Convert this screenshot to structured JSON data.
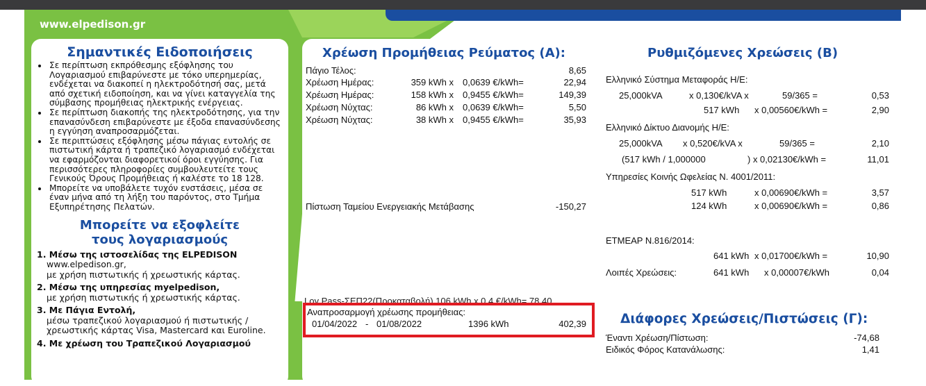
{
  "website": "www.elpedison.gr",
  "left_panel": {
    "title": "Σημαντικές Ειδοποιήσεις",
    "notices": [
      "Σε περίπτωση εκπρόθεσμης εξόφλησης του Λογαριασμού επιβαρύνεστε με τόκο υπερημερίας, ενδέχεται να διακοπεί η ηλεκτροδότησή σας, μετά από σχετική ειδοποίηση, και να γίνει καταγγελία της σύμβασης προμήθειας ηλεκτρικής ενέργειας.",
      "Σε περίπτωση διακοπής της ηλεκτροδότησης, για την επανασύνδεση επιβαρύνεστε με έξοδα επανασύνδεσης η εγγύηση αναπροσαρμόζεται.",
      "Σε περιπτώσεις εξόφλησης μέσω πάγιας εντολής σε πιστωτική κάρτα ή τραπεζικό λογαριασμό ενδέχεται να εφαρμόζονται διαφορετικοί όροι εγγύησης. Για περισσότερες πληροφορίες συμβουλευτείτε τους Γενικούς Όρους Προμήθειας ή καλέστε το 18 128.",
      "Μπορείτε να υποβάλετε τυχόν ενστάσεις, μέσα σε έναν μήνα από τη λήξη του παρόντος, στο Τμήμα Εξυπηρέτησης Πελατών."
    ],
    "pay_title_line1": "Μπορείτε να εξοφλείτε",
    "pay_title_line2": "τους λογαριασμούς",
    "pay_methods": [
      {
        "title": "1. Μέσω της ιστοσελίδας της ELPEDISON",
        "lines": [
          "www.elpedison.gr,",
          "με χρήση πιστωτικής ή χρεωστικής κάρτας."
        ]
      },
      {
        "title": "2. Μέσω της υπηρεσίας myelpedison,",
        "lines": [
          "με χρήση πιστωτικής ή χρεωστικής κάρτας."
        ]
      },
      {
        "title": "3. Με Πάγια Εντολή,",
        "lines": [
          "μέσω τραπεζικού λογαριασμού ή πιστωτικής /",
          "χρεωστικής κάρτας Visa, Mastercard και Euroline."
        ]
      },
      {
        "title": "4. Με χρέωση του Τραπεζικού Λογαριασμού",
        "lines": []
      }
    ]
  },
  "middle_panel": {
    "title": "Χρέωση Προμήθειας Ρεύματος (Α):",
    "fixed_label": "Πάγιο Τέλος:",
    "fixed_value": "8,65",
    "rows": [
      {
        "label": "Χρέωση Ημέρας:",
        "kwh": "359 kWh x",
        "rate": "0,0639 €/kWh=",
        "value": "22,94"
      },
      {
        "label": "Χρέωση Ημέρας:",
        "kwh": "158 kWh x",
        "rate": "0,9455 €/kWh=",
        "value": "149,39"
      },
      {
        "label": "Χρέωση Νύχτας:",
        "kwh": "86 kWh x",
        "rate": "0,0639 €/kWh=",
        "value": "5,50"
      },
      {
        "label": "Χρέωση Νύχτας:",
        "kwh": "38 kWh x",
        "rate": "0,9455 €/kWh=",
        "value": "35,93"
      }
    ],
    "credit_label": "Πίστωση Ταμείου Ενεργειακής Μετάβασης",
    "credit_value": "-150,27",
    "cut_line": "Loy Pass-ΣΕΠ22(Προκαταβολή)   106 kWh x  0,4 €/kWh=    78,40",
    "adjust_label": "Αναπροσαρμογή χρέωσης προμήθειας:",
    "adjust_from": "01/04/2022",
    "adjust_dash": "-",
    "adjust_to": "01/08/2022",
    "adjust_kwh": "1396 kWh",
    "adjust_value": "402,39"
  },
  "right_panel": {
    "title": "Ρυθμιζόμενες Χρεώσεις (Β)",
    "transmission_title": "Ελληνικό Σύστημα Μεταφοράς Η/Ε:",
    "t1": {
      "a": "25,000kVA",
      "b": "x  0,130€/kVA x",
      "c": "59/365  =",
      "v": "0,53"
    },
    "t2": {
      "a": "517 kWh",
      "b": "x  0,00560€/kWh =",
      "v": "2,90"
    },
    "distribution_title": "Ελληνικό Δίκτυο Διανομής Η/Ε:",
    "d1": {
      "a": "25,000kVA",
      "b": "x  0,520€/kVA   x",
      "c": "59/365   =",
      "v": "2,10"
    },
    "d2": {
      "a": "(517 kWh / 1,000000",
      "b": ") x  0,02130€/kWh =",
      "v": "11,01"
    },
    "pso_title": "Υπηρεσίες Κοινής Ωφελείας Ν. 4001/2011:",
    "p1": {
      "a": "517 kWh",
      "b": "x  0,00690€/kWh =",
      "v": "3,57"
    },
    "p2": {
      "a": "124 kWh",
      "b": "x  0,00690€/kWh =",
      "v": "0,86"
    },
    "etmear_title": "ΕΤΜΕΑΡ Ν.816/2014:",
    "e1": {
      "a": "641 kWh",
      "b": "x  0,01700€/kWh =",
      "v": "10,90"
    },
    "other_label": "Λοιπές Χρεώσεις:",
    "other_a": "641 kWh",
    "other_b": "x  0,00007€/kWh",
    "other_v": "0,04",
    "misc_title": "Διάφορες Χρεώσεις/Πιστώσεις (Γ):",
    "misc_rows": [
      {
        "label": "Έναντι Χρέωση/Πίστωση:",
        "value": "-74,68"
      },
      {
        "label": "Ειδικός Φόρος Κατανάλωσης:",
        "value": "1,41"
      }
    ]
  },
  "colors": {
    "green": "#7ac143",
    "blue": "#1a4ea0",
    "highlight": "#e01b22"
  }
}
